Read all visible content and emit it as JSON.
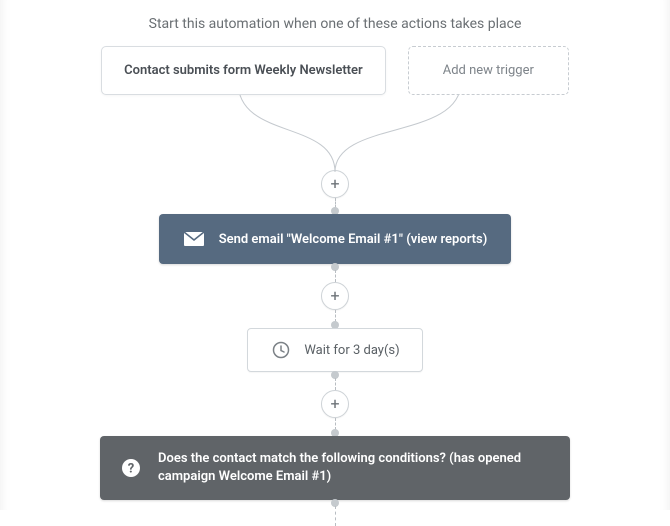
{
  "header": "Start this automation when one of these actions takes place",
  "triggers": {
    "item": "Contact submits form Weekly Newsletter",
    "add_label": "Add new trigger"
  },
  "plus": "+",
  "email_node": {
    "label": "Send email \"Welcome Email #1\" (view reports)"
  },
  "wait_node": {
    "label": "Wait for 3 day(s)"
  },
  "condition_node": {
    "label": "Does the contact match the following conditions? (has opened campaign Welcome Email #1)"
  }
}
